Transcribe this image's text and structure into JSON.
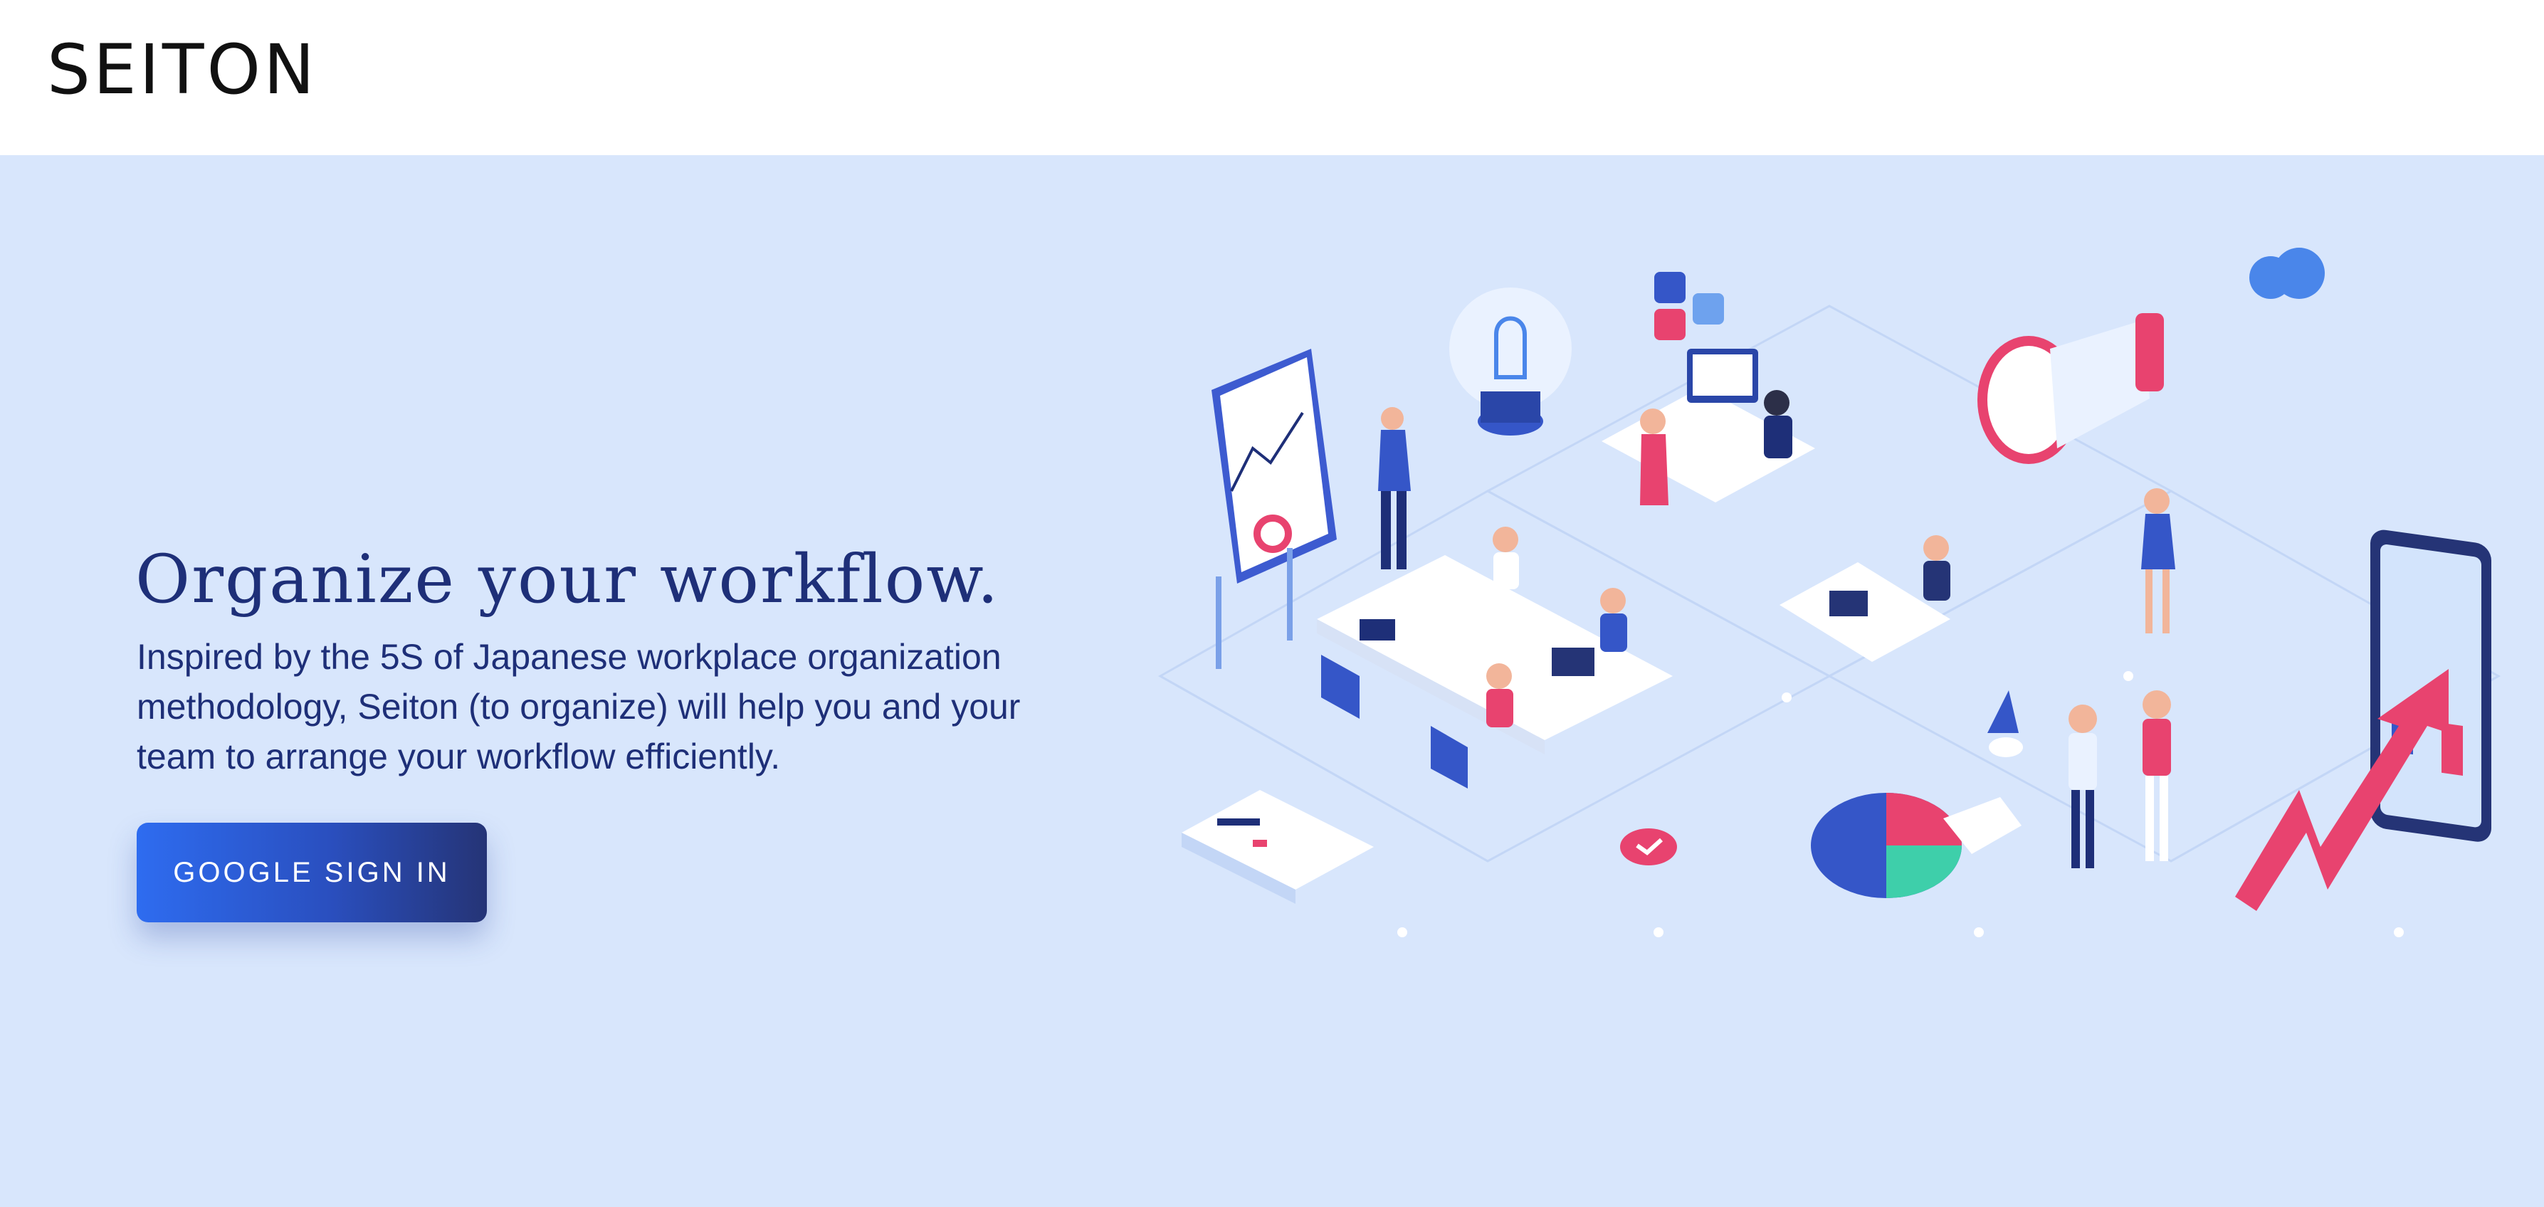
{
  "header": {
    "brand": "SEITON"
  },
  "hero": {
    "headline": "Organize your workflow.",
    "description": "Inspired by the 5S of Japanese workplace organization methodology, Seiton (to organize) will help you and your team to arrange your workflow efficiently.",
    "cta_label": "GOOGLE SIGN IN"
  },
  "colors": {
    "hero_background": "#d8e6fc",
    "heading_text": "#1e2f78",
    "button_gradient_start": "#2e6cf0",
    "button_gradient_end": "#253476",
    "accent_pink": "#e8436f",
    "accent_blue": "#3556c8"
  },
  "illustration": {
    "name": "isometric-office-teamwork-illustration"
  }
}
